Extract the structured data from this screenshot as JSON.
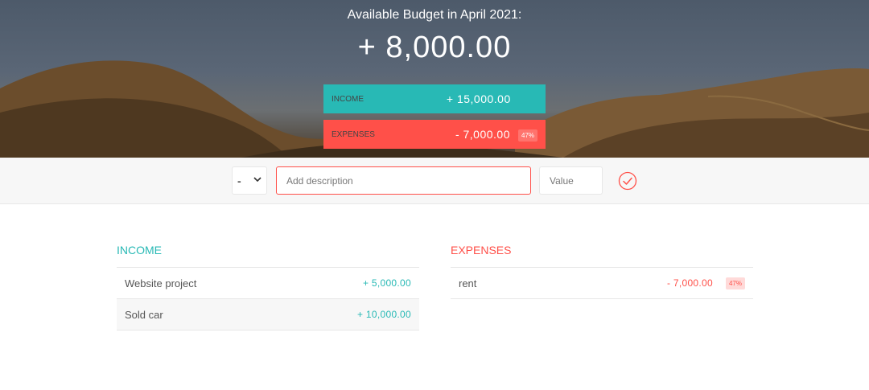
{
  "budget": {
    "title": "Available Budget in April 2021:",
    "value": "+ 8,000.00"
  },
  "summary": {
    "income_label": "Income",
    "income_value": "+ 15,000.00",
    "expenses_label": "Expenses",
    "expenses_value": "- 7,000.00",
    "expenses_percentage": "47%"
  },
  "add_form": {
    "type_value": "-",
    "type_icon": "chevron-down-icon",
    "description_placeholder": "Add description",
    "value_placeholder": "Value",
    "submit_icon": "checkmark-circle-icon"
  },
  "income": {
    "title": "Income",
    "items": [
      {
        "description": "Website project",
        "value": "+ 5,000.00"
      },
      {
        "description": "Sold car",
        "value": "+ 10,000.00"
      }
    ]
  },
  "expenses": {
    "title": "Expenses",
    "items": [
      {
        "description": "rent",
        "value": "- 7,000.00",
        "percentage": "47%"
      }
    ]
  },
  "colors": {
    "income": "#28B9B5",
    "expenses": "#FF5049",
    "background_bar": "#F7F7F7"
  }
}
